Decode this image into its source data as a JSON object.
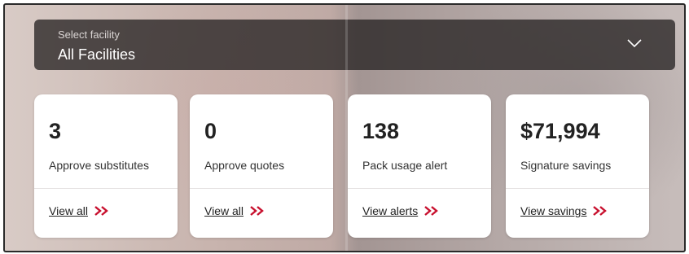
{
  "facility": {
    "label": "Select facility",
    "value": "All Facilities"
  },
  "cards": [
    {
      "value": "3",
      "label": "Approve substitutes",
      "link": "View all"
    },
    {
      "value": "0",
      "label": "Approve quotes",
      "link": "View all"
    },
    {
      "value": "138",
      "label": "Pack usage alert",
      "link": "View alerts"
    },
    {
      "value": "$71,994",
      "label": "Signature savings",
      "link": "View savings"
    }
  ],
  "colors": {
    "accent": "#c8102e",
    "select_bg": "#2b2626"
  },
  "icons": {
    "dropdown": "chevron-down-icon",
    "link_arrow": "double-chevron-right-icon"
  }
}
